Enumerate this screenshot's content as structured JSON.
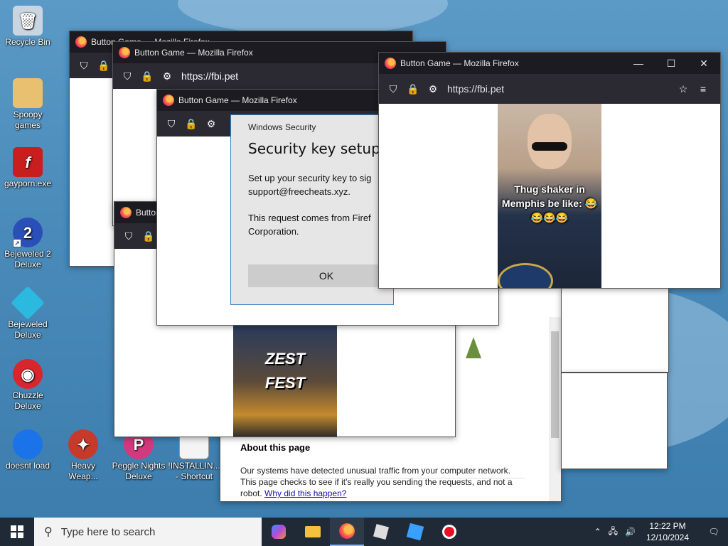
{
  "desktop": {
    "icons": [
      {
        "label": "Recycle Bin"
      },
      {
        "label": "Spoopy games"
      },
      {
        "label": "gayporn.exe"
      },
      {
        "label": "Bejeweled 2 Deluxe"
      },
      {
        "label": "Bejeweled Deluxe"
      },
      {
        "label": "Chuzzle Deluxe"
      },
      {
        "label": "doesnt load"
      },
      {
        "label": "Heavy Weap..."
      },
      {
        "label": "Peggle Nights Deluxe"
      },
      {
        "label": "!INSTALLIN... - Shortcut"
      }
    ]
  },
  "browser": {
    "window_title": "Button Game — Mozilla Firefox",
    "url": "https://fbi.pet"
  },
  "main_window": {
    "meme_caption": "Thug shaker in Memphis be like: 😂😂😂😂"
  },
  "zest_window": {
    "image_text_line1": "ZEST",
    "image_text_line2": "FEST"
  },
  "captcha_page": {
    "heading": "About this page",
    "body": "Our systems have detected unusual traffic from your computer network. This page checks to see if it's really you sending the requests, and not a robot.",
    "link": "Why did this happen?"
  },
  "security_dialog": {
    "header": "Windows Security",
    "title": "Security key setup",
    "line1": "Set up your security key to sig",
    "line2": "support@freecheats.xyz.",
    "line3": "This request comes from Firef",
    "line4": "Corporation.",
    "ok_label": "OK"
  },
  "taskbar": {
    "search_placeholder": "Type here to search",
    "time": "12:22 PM",
    "date": "12/10/2024"
  }
}
